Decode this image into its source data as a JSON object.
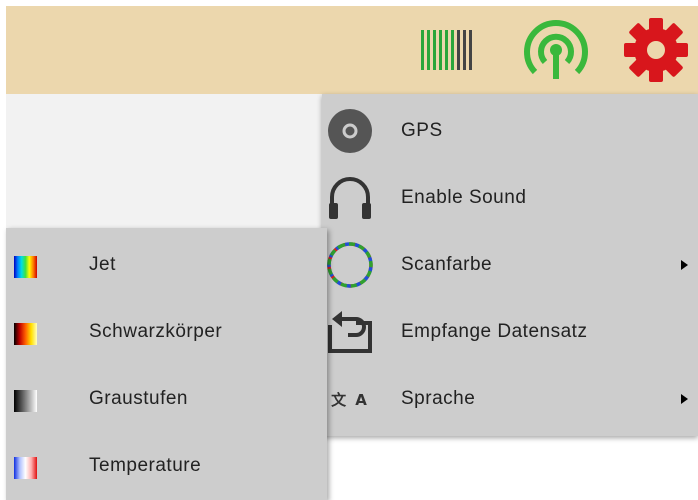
{
  "toolbar": {
    "icons": [
      "barcode-icon",
      "antenna-signal-icon",
      "settings-gear-icon"
    ],
    "colors": {
      "background": "#ecd7ad",
      "barcode": "#2aa63a",
      "antenna": "#3ab83c",
      "gear": "#d8161c"
    }
  },
  "menu": {
    "background": "#cdcdcd",
    "items": [
      {
        "label": "GPS",
        "icon": "gps-disc-icon",
        "has_submenu": false
      },
      {
        "label": "Enable Sound",
        "icon": "headphones-icon",
        "has_submenu": false
      },
      {
        "label": "Scanfarbe",
        "icon": "color-ring-icon",
        "has_submenu": true
      },
      {
        "label": "Empfange Datensatz",
        "icon": "receive-dataset-icon",
        "has_submenu": false
      },
      {
        "label": "Sprache",
        "icon": "translate-icon",
        "icon_text": "文 A",
        "has_submenu": true
      }
    ]
  },
  "submenu": {
    "items": [
      {
        "label": "Jet",
        "swatch": "jet-colormap-icon"
      },
      {
        "label": "Schwarzkörper",
        "swatch": "blackbody-colormap-icon"
      },
      {
        "label": "Graustufen",
        "swatch": "grayscale-colormap-icon"
      },
      {
        "label": "Temperature",
        "swatch": "temperature-colormap-icon"
      }
    ]
  }
}
